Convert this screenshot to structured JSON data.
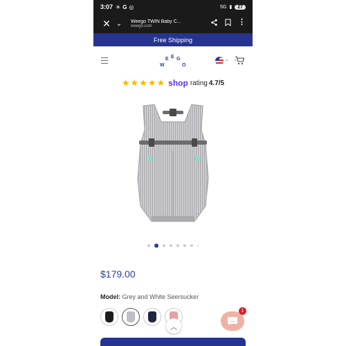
{
  "status_bar": {
    "time": "3:07",
    "left_icons": [
      "sun-icon",
      "google-icon",
      "instagram-icon"
    ],
    "network": "5G",
    "battery": "27"
  },
  "browser": {
    "page_title": "Weego TWIN Baby C...",
    "url": "weego.com"
  },
  "banner": {
    "text": "Free Shipping"
  },
  "header": {
    "logo_letters": [
      "W",
      "E",
      "E",
      "G",
      "O"
    ]
  },
  "rating": {
    "brand": "shop",
    "label": "rating",
    "value": "4.7/5",
    "stars": 4.7
  },
  "product": {
    "image_alt": "Weego TWIN Baby Carrier in Grey and White Seersucker",
    "price": "$179.00",
    "model_label": "Model:",
    "model_value": "Grey and White Seersucker",
    "gallery_count": 8,
    "gallery_active_index": 1,
    "swatches": [
      {
        "name": "black",
        "color": "#1d1d1d"
      },
      {
        "name": "grey-white-seersucker",
        "color": "#b9b9bd"
      },
      {
        "name": "navy",
        "color": "#1f2640"
      },
      {
        "name": "pink",
        "color": "#e8a0a8"
      }
    ]
  },
  "chat": {
    "badge_count": "1"
  },
  "colors": {
    "brand_blue": "#26348f",
    "star": "#f4b800",
    "shop_purple": "#5a31f4",
    "chat": "#eeb2a4"
  }
}
